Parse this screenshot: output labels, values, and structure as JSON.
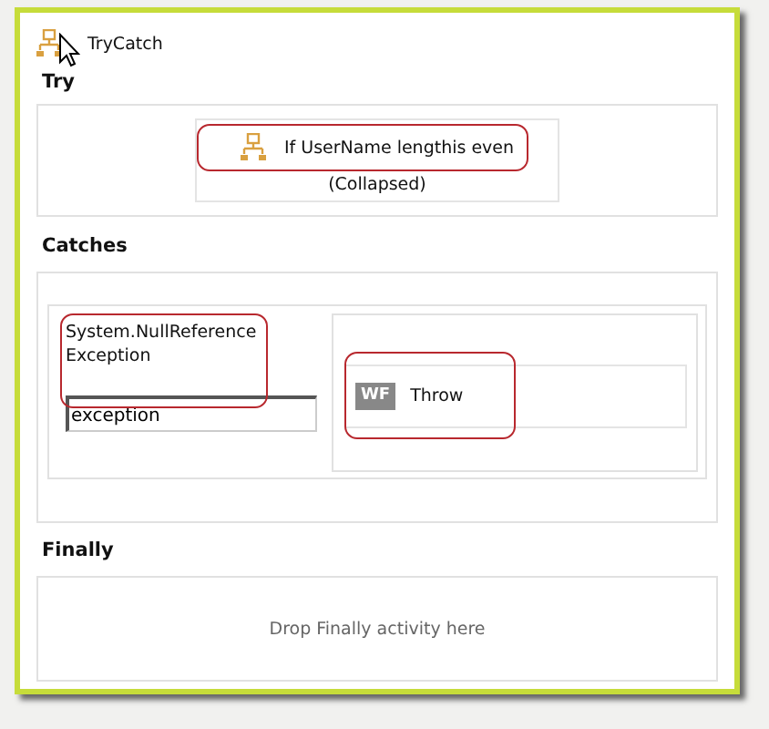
{
  "designer": {
    "title": "TryCatch",
    "try": {
      "label": "Try",
      "activity": {
        "title": "If UserName lengthis even",
        "state": "(Collapsed)"
      }
    },
    "catches": {
      "label": "Catches",
      "items": [
        {
          "exception_type": "System.NullReferenceException",
          "variable": "exception",
          "activity": {
            "badge": "WF",
            "title": "Throw"
          }
        }
      ]
    },
    "finally": {
      "label": "Finally",
      "placeholder": "Drop Finally activity here"
    }
  }
}
